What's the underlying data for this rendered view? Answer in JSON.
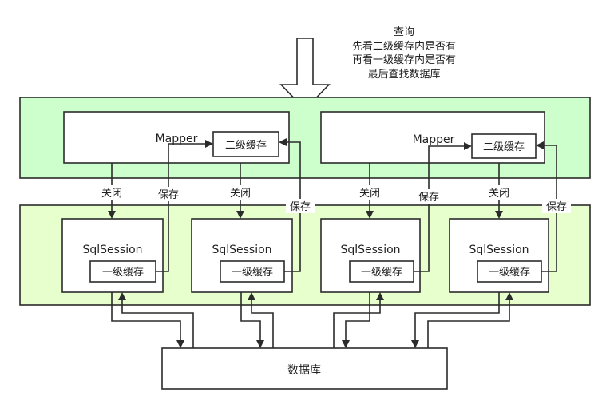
{
  "query_note": {
    "line1": "查询",
    "line2": "先看二级缓存内是否有",
    "line3": "再看一级缓存内是否有",
    "line4": "最后查找数据库"
  },
  "mapper_left": {
    "title": "Mapper",
    "cache": "二级缓存"
  },
  "mapper_right": {
    "title": "Mapper",
    "cache": "二级缓存"
  },
  "sessions": [
    {
      "title": "SqlSession",
      "cache": "一级缓存"
    },
    {
      "title": "SqlSession",
      "cache": "一级缓存"
    },
    {
      "title": "SqlSession",
      "cache": "一级缓存"
    },
    {
      "title": "SqlSession",
      "cache": "一级缓存"
    }
  ],
  "edge_labels": {
    "close": "关闭",
    "save": "保存"
  },
  "database": {
    "label": "数据库"
  },
  "colors": {
    "mapper_layer_fill": "#ccffcc",
    "session_layer_fill": "#e6ffcc",
    "stroke": "#2b2b2b"
  }
}
